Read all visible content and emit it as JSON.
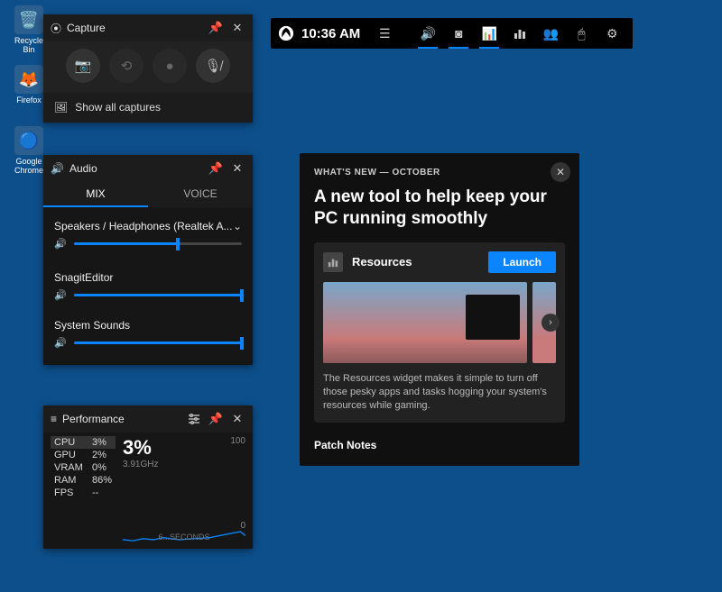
{
  "desktop": {
    "icons": [
      "Recycle Bin",
      "Firefox",
      "Google Chrome"
    ]
  },
  "capture": {
    "title": "Capture",
    "showAll": "Show all captures"
  },
  "audio": {
    "title": "Audio",
    "tabMix": "MIX",
    "tabVoice": "VOICE",
    "device": "Speakers / Headphones (Realtek A...",
    "apps": [
      "SnagitEditor",
      "System Sounds"
    ]
  },
  "perf": {
    "title": "Performance",
    "rows": [
      {
        "lab": "CPU",
        "val": "3%"
      },
      {
        "lab": "GPU",
        "val": "2%"
      },
      {
        "lab": "VRAM",
        "val": "0%"
      },
      {
        "lab": "RAM",
        "val": "86%"
      },
      {
        "lab": "FPS",
        "val": "--"
      }
    ],
    "big": "3%",
    "freq": "3.91GHz",
    "hi": "100",
    "lo": "0",
    "time": "6...SECONDS"
  },
  "topbar": {
    "time": "10:36 AM"
  },
  "popup": {
    "caption": "WHAT'S NEW — OCTOBER",
    "headline": "A new tool to help keep your PC running smoothly",
    "cardTitle": "Resources",
    "launch": "Launch",
    "desc": "The Resources widget makes it simple to turn off those pesky apps and tasks hogging your system's resources while gaming.",
    "patch": "Patch Notes"
  }
}
